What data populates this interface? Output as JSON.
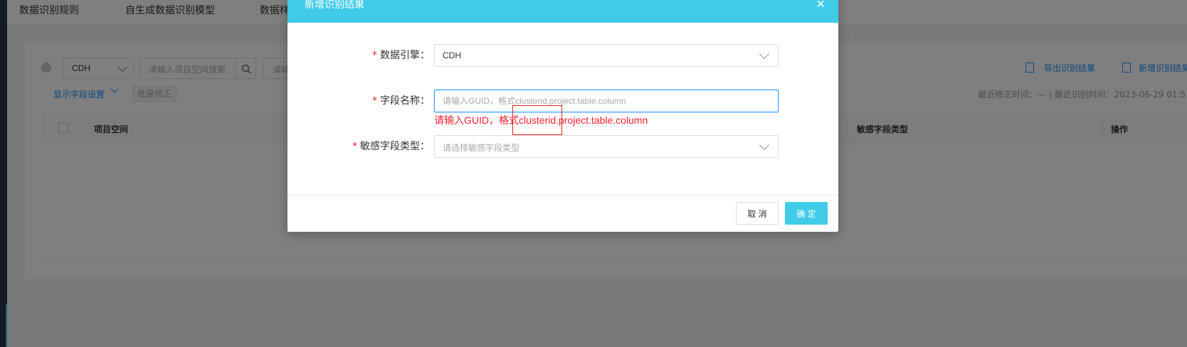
{
  "colors": {
    "modal_header": "#40cce8",
    "confirm_button": "#40cce8",
    "error": "#f5222d",
    "link": "#1890ff",
    "overlay": "rgba(0,0,0,0.5)"
  },
  "topnav": {
    "tabs": [
      "数据识别规则",
      "自生成数据识别模型",
      "数据样"
    ]
  },
  "toolbar": {
    "engine_select_value": "CDH",
    "project_search_placeholder": "请输入项目空间搜索",
    "second_search_placeholder": "请输",
    "export_label": "导出识别结果",
    "add_label": "新增识别结果",
    "display_fields_label": "显示字段设置",
    "batch_fix_label": "批量修正",
    "meta_info": "最近修正时间：— | 最近识别时间：2023-06-29 01:5"
  },
  "table": {
    "headers": [
      "项目空间",
      "敏感字段类型",
      "操作"
    ]
  },
  "modal": {
    "title": "新增识别结果",
    "close_icon": "close-icon",
    "fields": {
      "engine": {
        "label": "数据引擎：",
        "required_mark": "*",
        "value": "CDH"
      },
      "field_name": {
        "label": "字段名称：",
        "required_mark": "*",
        "placeholder": "请输入GUID，格式clusterid.project.table.column",
        "error": "请输入GUID，格式clusterid.project.table.column"
      },
      "sensitive_type": {
        "label": "敏感字段类型：",
        "required_mark": "*",
        "placeholder": "请选择敏感字段类型"
      }
    },
    "cancel_label": "取 消",
    "confirm_label": "确 定"
  }
}
